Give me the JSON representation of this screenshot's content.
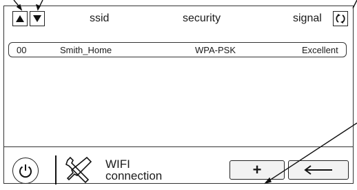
{
  "header": {
    "scroll_up_icon": "triangle-up",
    "scroll_down_icon": "triangle-down",
    "columns": {
      "ssid": "ssid",
      "security": "security",
      "signal": "signal"
    },
    "refresh_icon": "refresh"
  },
  "networks": [
    {
      "index": "00",
      "ssid": "Smith_Home",
      "security": "WPA-PSK",
      "signal": "Excellent"
    }
  ],
  "footer": {
    "power_icon": "power",
    "tools_icon": "wrench-screwdriver",
    "section_label_line1": "WIFI",
    "section_label_line2": "connection",
    "add_label": "+",
    "back_icon": "arrow-left"
  },
  "colors": {
    "stroke": "#222222",
    "button_bg": "#f2f2f2"
  }
}
